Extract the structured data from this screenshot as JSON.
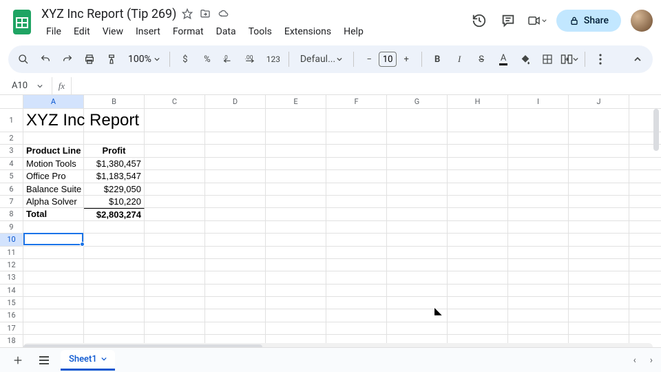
{
  "header": {
    "doc_title": "XYZ Inc Report (Tip 269)",
    "share_label": "Share"
  },
  "menu": {
    "items": [
      "File",
      "Edit",
      "View",
      "Insert",
      "Format",
      "Data",
      "Tools",
      "Extensions",
      "Help"
    ]
  },
  "toolbar": {
    "zoom": "100%",
    "font_name": "Defaul...",
    "font_size": "10",
    "currency": "$",
    "percent": "%",
    "format_number": "123"
  },
  "namebox": {
    "ref": "A10",
    "fx": "fx",
    "formula": ""
  },
  "columns": [
    "A",
    "B",
    "C",
    "D",
    "E",
    "F",
    "G",
    "H",
    "I",
    "J"
  ],
  "row_numbers": [
    1,
    2,
    3,
    4,
    5,
    6,
    7,
    8,
    9,
    10,
    11,
    12,
    13,
    14,
    15,
    16,
    17,
    18
  ],
  "sheet": {
    "title_text": "XYZ Inc Report",
    "header_a": "Product Line",
    "header_b": "Profit",
    "rows": [
      {
        "name": "Motion Tools",
        "profit": "$1,380,457"
      },
      {
        "name": "Office Pro",
        "profit": "$1,183,547"
      },
      {
        "name": "Balance Suite",
        "profit": "$229,050"
      },
      {
        "name": "Alpha Solver",
        "profit": "$10,220"
      }
    ],
    "total_label": "Total",
    "total_value": "$2,803,274"
  },
  "active_cell": {
    "col": "A",
    "row": 10
  },
  "tabs": {
    "sheet1": "Sheet1"
  }
}
